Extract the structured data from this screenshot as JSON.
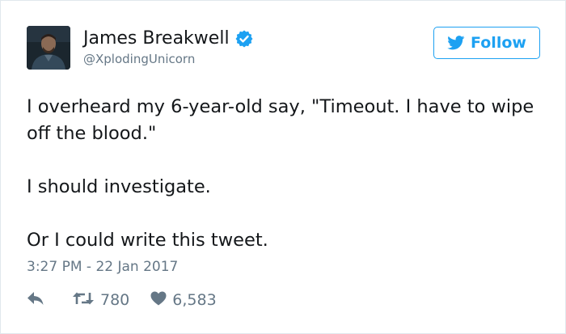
{
  "author": {
    "display_name": "James Breakwell",
    "handle": "@XplodingUnicorn",
    "verified": true,
    "avatar": "profile-photo"
  },
  "follow_button": {
    "label": "Follow",
    "icon": "twitter-bird-icon"
  },
  "tweet": {
    "paragraphs": [
      "I overheard my 6-year-old say, \"Timeout. I have to wipe off the blood.\"",
      "I should investigate.",
      "Or I could write this tweet."
    ],
    "timestamp": "3:27 PM - 22 Jan 2017"
  },
  "actions": {
    "reply": {
      "icon": "reply-icon"
    },
    "retweet": {
      "icon": "retweet-icon",
      "count": "780"
    },
    "like": {
      "icon": "heart-icon",
      "count": "6,583"
    }
  },
  "colors": {
    "brand_blue": "#1da1f2",
    "text_primary": "#14171a",
    "text_secondary": "#657786",
    "border": "#e1e8ed"
  }
}
